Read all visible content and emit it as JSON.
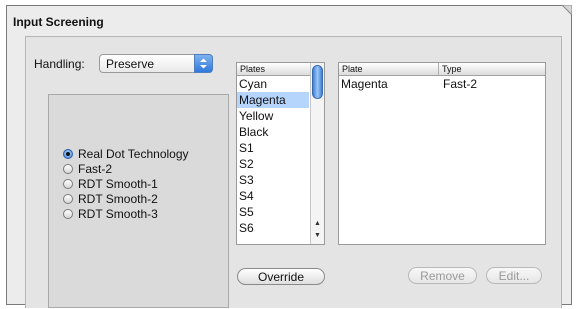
{
  "panel": {
    "title": "Input Screening"
  },
  "handling": {
    "label": "Handling:",
    "value": "Preserve"
  },
  "radio_options": [
    {
      "label": "Real Dot Technology",
      "selected": true
    },
    {
      "label": "Fast-2",
      "selected": false
    },
    {
      "label": "RDT Smooth-1",
      "selected": false
    },
    {
      "label": "RDT Smooth-2",
      "selected": false
    },
    {
      "label": "RDT Smooth-3",
      "selected": false
    }
  ],
  "plates_list": {
    "header": "Plates",
    "items": [
      "Cyan",
      "Magenta",
      "Yellow",
      "Black",
      "S1",
      "S2",
      "S3",
      "S4",
      "S5",
      "S6"
    ],
    "selected": "Magenta"
  },
  "assignments": {
    "headers": {
      "plate": "Plate",
      "type": "Type"
    },
    "rows": [
      {
        "plate": "Magenta",
        "type": "Fast-2"
      }
    ]
  },
  "buttons": {
    "override": "Override",
    "remove": "Remove",
    "edit": "Edit..."
  },
  "colors": {
    "selection": "#b5d5fd",
    "accent": "#2f78db"
  }
}
